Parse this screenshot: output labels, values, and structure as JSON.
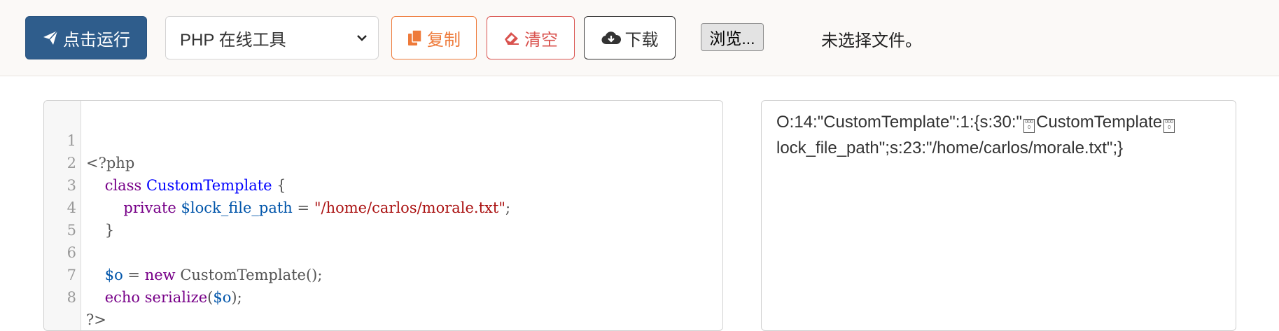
{
  "toolbar": {
    "run_label": "点击运行",
    "language_select": "PHP 在线工具",
    "copy_label": "复制",
    "clear_label": "清空",
    "download_label": "下载",
    "browse_label": "浏览...",
    "file_status": "未选择文件。"
  },
  "editor": {
    "line_numbers": [
      "1",
      "2",
      "3",
      "4",
      "5",
      "6",
      "7",
      "8"
    ],
    "tokens": {
      "php_open": "<?php",
      "class_kw": "class",
      "class_name": "CustomTemplate",
      "brace_open": "{",
      "private_kw": "private",
      "prop_name": "$lock_file_path",
      "assign": "=",
      "path_str": "\"/home/carlos/morale.txt\"",
      "semi": ";",
      "brace_close": "}",
      "var_o": "$o",
      "new_kw": "new",
      "ctor_call": "CustomTemplate();",
      "echo_kw": "echo",
      "serialize_fn": "serialize",
      "paren_open": "(",
      "paren_close_semi": ");",
      "php_close": "?>"
    }
  },
  "output": {
    "part1": "O:14:\"CustomTemplate\":1:{s:30:\"",
    "part2": "CustomTemplate",
    "part3": "lock_file_path\";s:23:\"/home/carlos/morale.txt\";}",
    "ctrl_glyph": "0000"
  },
  "colors": {
    "run_bg": "#2f5d8c",
    "copy": "#ee7a3a",
    "clear": "#d9534f"
  },
  "icons": {
    "run": "paper-plane-icon",
    "copy": "copy-icon",
    "clear": "eraser-icon",
    "download": "cloud-download-icon",
    "select": "chevron-down-icon"
  }
}
